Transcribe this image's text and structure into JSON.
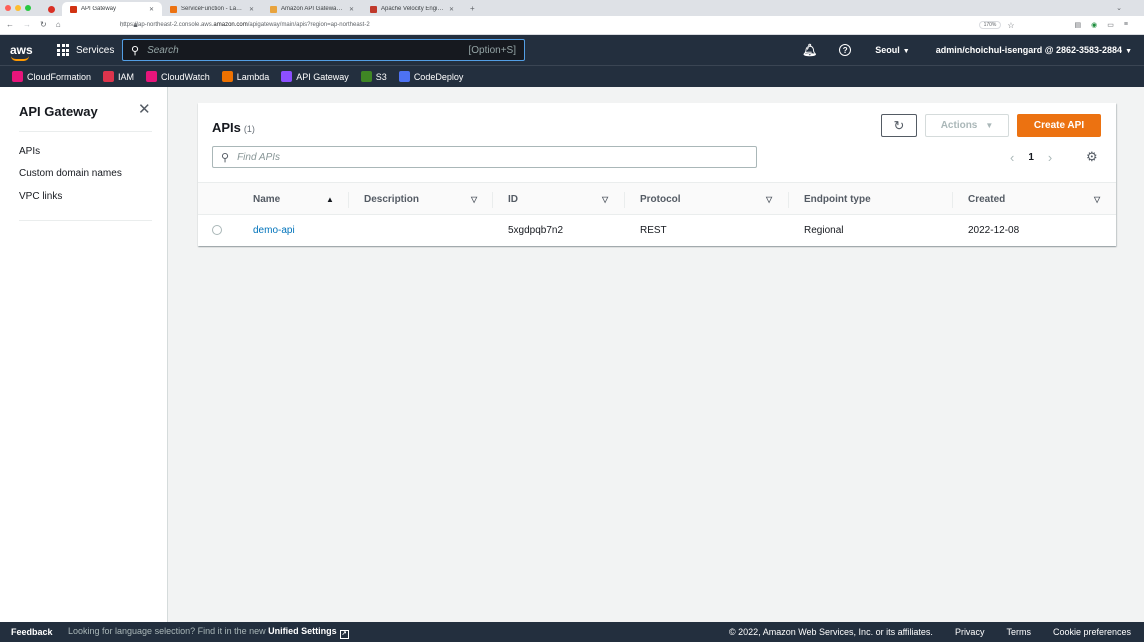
{
  "browser": {
    "tabs": [
      {
        "label": "API Gateway",
        "fav_color": "#d13212",
        "active": true
      },
      {
        "label": "ServiceFunction - Lambda",
        "fav_color": "#ec7211",
        "active": false
      },
      {
        "label": "Amazon API Gateway API reque...",
        "fav_color": "#e8a33d",
        "active": false
      },
      {
        "label": "Apache Velocity Engine VTL Ref",
        "fav_color": "#c0392b",
        "active": false
      }
    ],
    "url_prefix": "https://ap-northeast-2.console.aws.",
    "url_host": "amazon.com",
    "url_path": "/apigateway/main/apis?region=ap-northeast-2",
    "zoom": "170%"
  },
  "aws_header": {
    "logo": "aws",
    "services_label": "Services",
    "search_placeholder": "Search",
    "search_shortcut": "[Option+S]",
    "region": "Seoul",
    "account": "admin/choichul-isengard @ 2862-3583-2884"
  },
  "favorites": [
    {
      "label": "CloudFormation",
      "color": "#e7157b"
    },
    {
      "label": "IAM",
      "color": "#dd344c"
    },
    {
      "label": "CloudWatch",
      "color": "#e7157b"
    },
    {
      "label": "Lambda",
      "color": "#ed7100"
    },
    {
      "label": "API Gateway",
      "color": "#8c4fff"
    },
    {
      "label": "S3",
      "color": "#3f8624"
    },
    {
      "label": "CodeDeploy",
      "color": "#4d72f3"
    }
  ],
  "sidebar": {
    "title": "API Gateway",
    "items": [
      {
        "label": "APIs"
      },
      {
        "label": "Custom domain names"
      },
      {
        "label": "VPC links"
      }
    ]
  },
  "apis_panel": {
    "title": "APIs",
    "count": "(1)",
    "actions_label": "Actions",
    "create_label": "Create API",
    "find_placeholder": "Find APIs",
    "page": "1",
    "columns": [
      "Name",
      "Description",
      "ID",
      "Protocol",
      "Endpoint type",
      "Created"
    ],
    "rows": [
      {
        "name": "demo-api",
        "description": "",
        "id": "5xgdpqb7n2",
        "protocol": "REST",
        "endpoint_type": "Regional",
        "created": "2022-12-08"
      }
    ]
  },
  "footer": {
    "feedback": "Feedback",
    "lang_prefix": "Looking for language selection? Find it in the new",
    "lang_link": "Unified Settings",
    "copyright": "© 2022, Amazon Web Services, Inc. or its affiliates.",
    "privacy": "Privacy",
    "terms": "Terms",
    "cookies": "Cookie preferences"
  }
}
